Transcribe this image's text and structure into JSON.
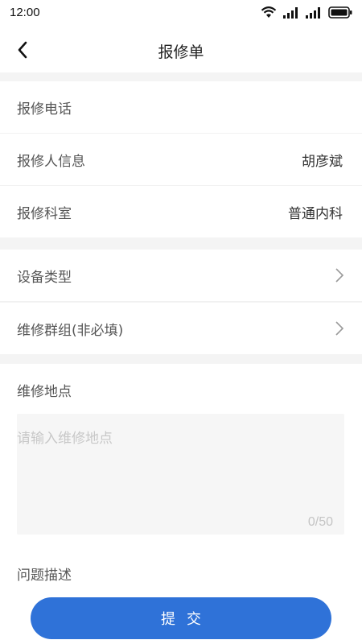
{
  "status_bar": {
    "time": "12:00",
    "icons": [
      "wifi-icon",
      "signal-icon",
      "signal-icon",
      "battery-icon"
    ]
  },
  "header": {
    "title": "报修单",
    "back_icon": "chevron-left-icon"
  },
  "form": {
    "phone": {
      "label": "报修电话",
      "value": ""
    },
    "reporter": {
      "label": "报修人信息",
      "value": "胡彦斌"
    },
    "department": {
      "label": "报修科室",
      "value": "普通内科"
    },
    "device_type": {
      "label": "设备类型",
      "icon": "chevron-right-icon"
    },
    "repair_group": {
      "label": "维修群组(非必填)",
      "icon": "chevron-right-icon"
    },
    "location": {
      "label": "维修地点",
      "placeholder": "请输入维修地点",
      "counter": "0/50"
    },
    "description": {
      "label": "问题描述"
    }
  },
  "submit": {
    "label": "提交"
  },
  "colors": {
    "primary": "#2f72d8",
    "background": "#f4f4f4",
    "placeholder": "#c8c8c8"
  }
}
